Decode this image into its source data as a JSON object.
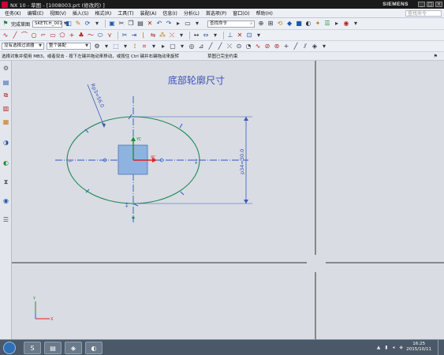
{
  "window": {
    "title": "NX 10 - 草图 - [1008003.prt (修改的) ]",
    "brand": "SIEMENS",
    "controls": [
      "_",
      "□",
      "×"
    ]
  },
  "menubar": {
    "items": [
      "任务(K)",
      "编辑(E)",
      "视图(V)",
      "插入(S)",
      "格式(R)",
      "工具(T)",
      "装配(A)",
      "信息(I)",
      "分析(L)",
      "首选项(P)",
      "窗口(O)",
      "帮助(H)"
    ],
    "search_placeholder": "查找命令"
  },
  "toolbar": {
    "finish_sketch_label": "完成草图",
    "sketch_name": "SKETCH_001",
    "filter_label": "没有选择过滤器",
    "assembly_scope": "整个装配"
  },
  "cue": {
    "prompt": "选择对象并使用 MB3，或者双击 - 按下左键并拖动来移动，或按住 Ctrl 键并右键拖动来旋转",
    "status": "草图已完全约束"
  },
  "canvas": {
    "annotation_title": "底部轮廓尺寸",
    "radius_dim": "Rp3=56.0",
    "vertical_dim": "p34=30.0",
    "axis_x": "XC",
    "axis_y": "YC",
    "triad_x": "X",
    "triad_y": "Y",
    "colors": {
      "background": "#d9dce2",
      "ellipse": "#1c8a5a",
      "dimension": "#3a5ab8",
      "axis": "#2b57c9",
      "square_fill": "#8fb3e0",
      "annotation": "#3a4fb8"
    }
  },
  "taskbar": {
    "time": "16:25",
    "date": "2015/10/11"
  }
}
